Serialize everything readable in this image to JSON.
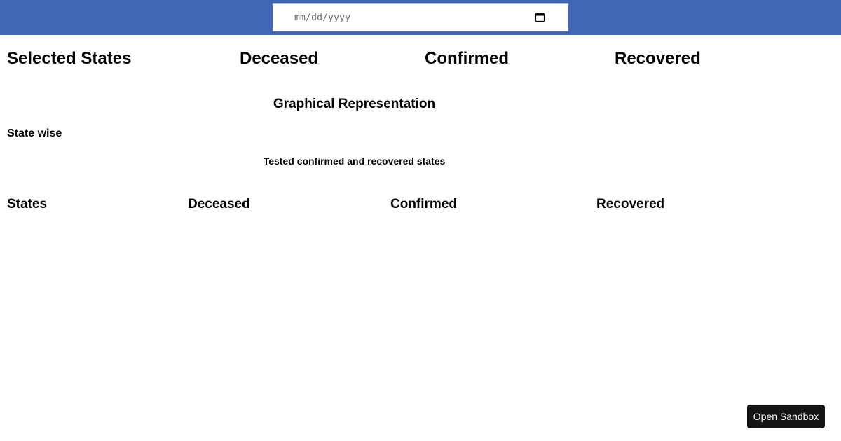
{
  "header": {
    "date_input": {
      "placeholder": "mm/dd/yyyy",
      "value": ""
    },
    "accent_color": "#4267b2"
  },
  "summary": {
    "labels": [
      "Selected States",
      "Deceased",
      "Confirmed",
      "Recovered"
    ]
  },
  "graph_section": {
    "title": "Graphical Representation",
    "subtitle": "State wise",
    "caption": "Tested confirmed and recovered states"
  },
  "table": {
    "headers": [
      "States",
      "Deceased",
      "Confirmed",
      "Recovered"
    ]
  },
  "sandbox": {
    "button_label": "Open Sandbox"
  }
}
